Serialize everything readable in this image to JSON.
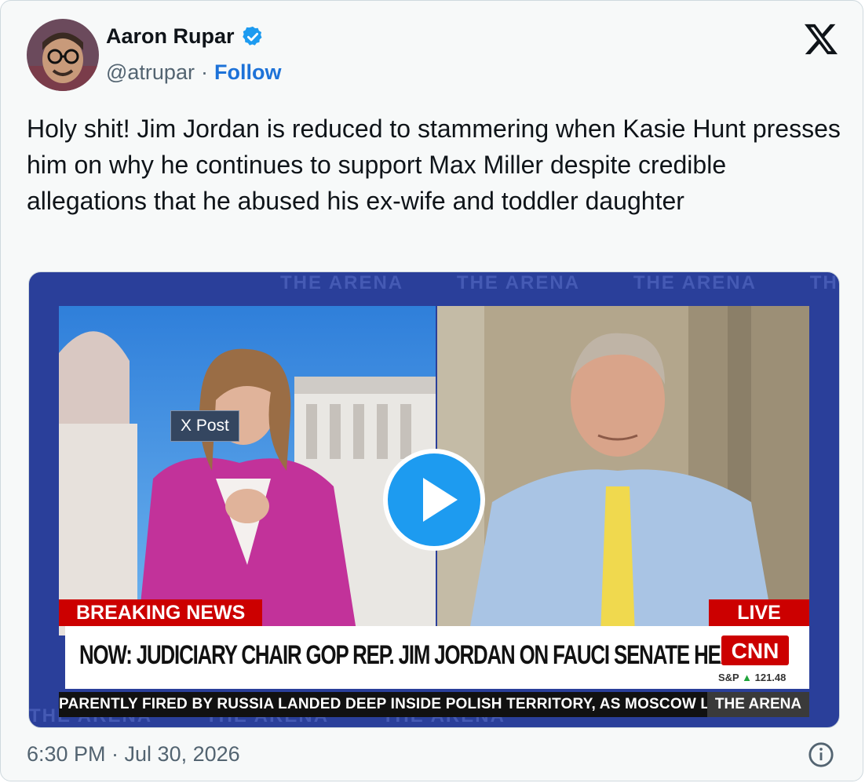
{
  "author": {
    "name": "Aaron Rupar",
    "handle": "@atrupar",
    "separator": "·",
    "follow_label": "Follow",
    "verified": true
  },
  "tweet": {
    "text": "Holy shit! Jim Jordan is reduced to stammering when Kasie Hunt presses him on why he continues to support Max Miller despite credible allegations that he abused his ex-wife and toddler daughter",
    "timestamp": "6:30 PM · Jul 30, 2026"
  },
  "media": {
    "badge": "X Post",
    "breaking_label": "BREAKING NEWS",
    "live_label": "LIVE",
    "headline": "NOW: JUDICIARY CHAIR GOP REP. JIM JORDAN ON FAUCI SENATE HEARING",
    "network": "CNN",
    "market_label": "S&P",
    "market_value": "121.48",
    "ticker": "PARENTLY FIRED BY RUSSIA LANDED DEEP INSIDE POLISH TERRITORY, AS MOSCOW LA",
    "show_tag": "THE ARENA",
    "watermark": "THE ARENA"
  },
  "icons": {
    "brand": "x-logo-icon",
    "verified": "verified-badge-icon",
    "play": "play-icon",
    "info": "info-icon"
  },
  "colors": {
    "accent": "#1d9bf0",
    "follow": "#1d72d8",
    "cnn_red": "#cc0000"
  }
}
